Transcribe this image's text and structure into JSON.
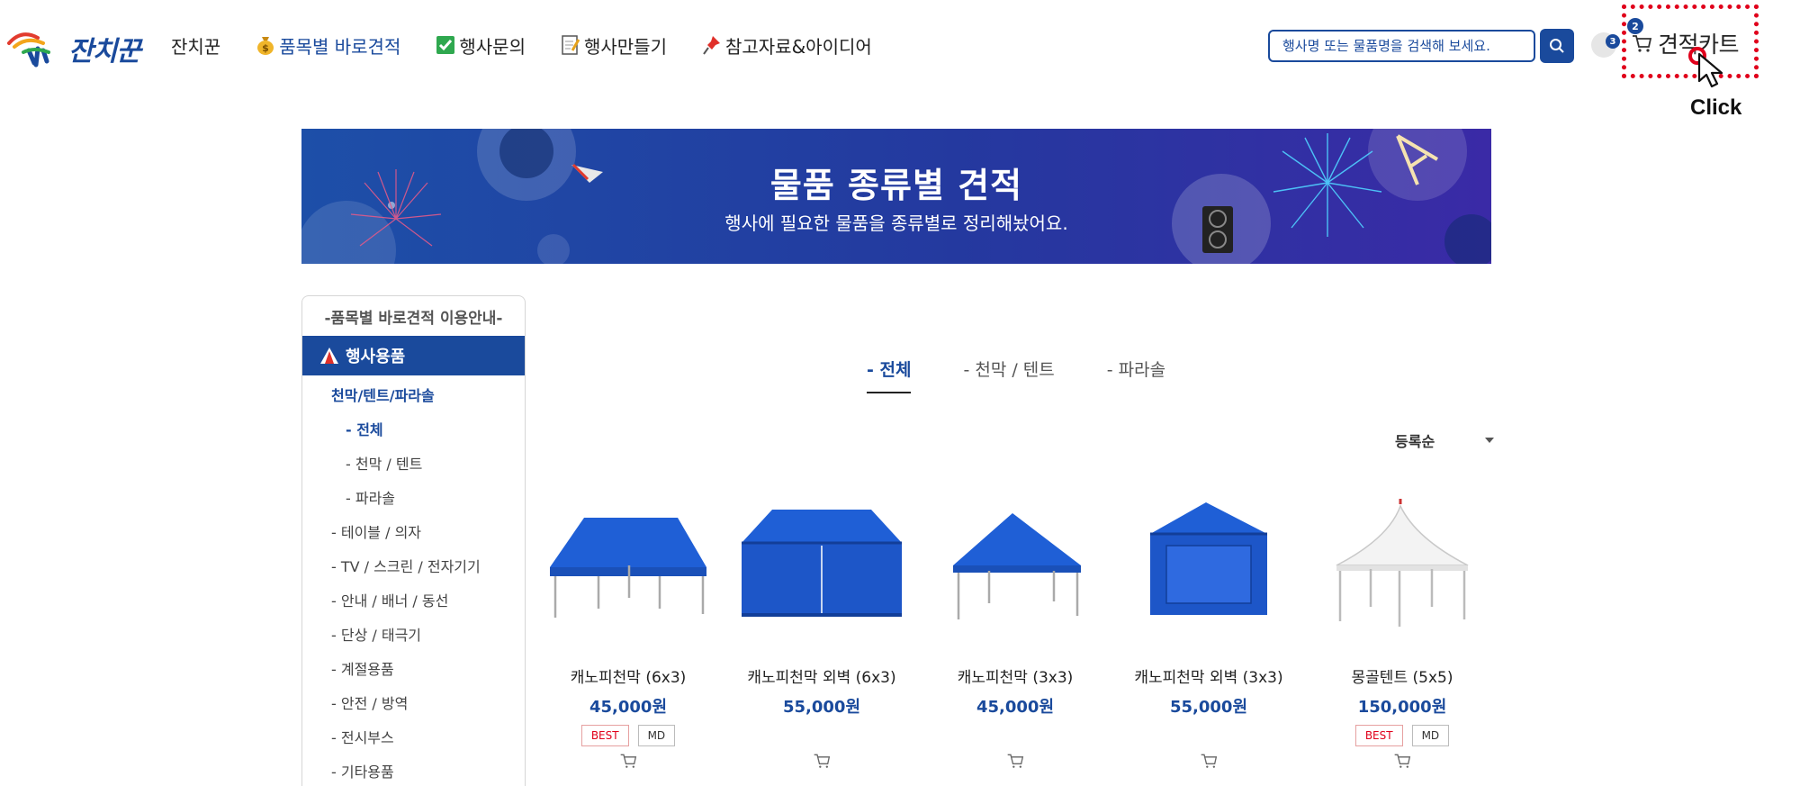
{
  "header": {
    "logo_text": "잔치꾼",
    "nav": [
      {
        "label": "잔치꾼",
        "icon": ""
      },
      {
        "label": "품목별 바로견적",
        "icon": "money-bag-icon",
        "active": true
      },
      {
        "label": "행사문의",
        "icon": "checkbox-icon"
      },
      {
        "label": "행사만들기",
        "icon": "memo-icon"
      },
      {
        "label": "참고자료&아이디어",
        "icon": "pushpin-icon"
      }
    ],
    "search": {
      "placeholder": "행사명 또는 물품명을 검색해 보세요."
    },
    "user_badge": "3",
    "cart": {
      "label": "견적카트",
      "count": "2"
    },
    "click_hint": "Click",
    "accent_color": "#1a4a9c",
    "highlight_color": "#e0001b"
  },
  "banner": {
    "title": "물품 종류별 견적",
    "subtitle": "행사에 필요한 물품을 종류별로 정리해놨어요."
  },
  "sidebar": {
    "guide": "-품목별 바로견적 이용안내-",
    "category": "행사용품",
    "sub": "천막/텐트/파라솔",
    "sub_items": [
      "- 전체",
      "- 천막 / 텐트",
      "- 파라솔"
    ],
    "items": [
      "- 테이블 / 의자",
      "- TV / 스크린 / 전자기기",
      "- 안내 / 배너 / 동선",
      "- 단상 / 태극기",
      "- 계절용품",
      "- 안전 / 방역",
      "- 전시부스",
      "- 기타용품"
    ]
  },
  "tabs": [
    "- 전체",
    "- 천막 / 텐트",
    "- 파라솔"
  ],
  "sort": {
    "selected": "등록순"
  },
  "products": [
    {
      "name": "캐노피천막 (6x3)",
      "price": "45,000원",
      "badges": [
        "BEST",
        "MD"
      ]
    },
    {
      "name": "캐노피천막 외벽 (6x3)",
      "price": "55,000원",
      "badges": []
    },
    {
      "name": "캐노피천막 (3x3)",
      "price": "45,000원",
      "badges": []
    },
    {
      "name": "캐노피천막 외벽 (3x3)",
      "price": "55,000원",
      "badges": []
    },
    {
      "name": "몽골텐트 (5x5)",
      "price": "150,000원",
      "badges": [
        "BEST",
        "MD"
      ]
    }
  ]
}
